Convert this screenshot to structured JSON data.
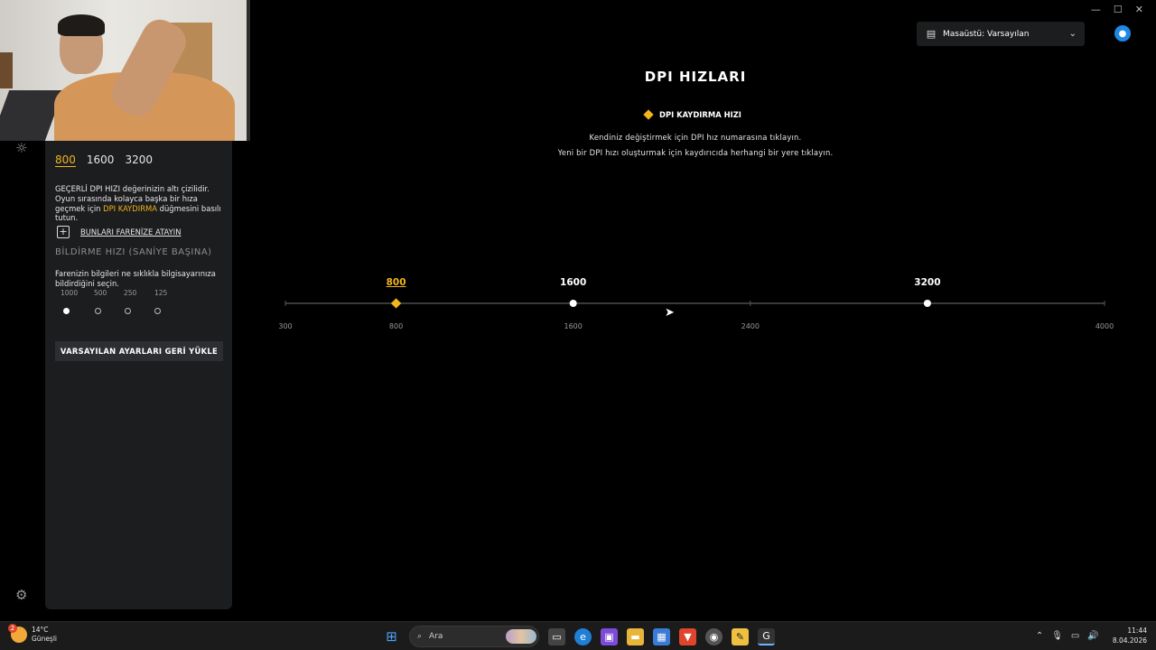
{
  "window_controls": {
    "minimize": "—",
    "maximize": "☐",
    "close": "✕"
  },
  "rail": {
    "light_icon": "light-icon",
    "settings_icon": "gear-icon"
  },
  "panel": {
    "dpi_values": [
      "800",
      "1600",
      "3200"
    ],
    "dpi_active_index": 0,
    "info_line1": "GEÇERLİ DPI HIZI değerinizin altı çizilidir.",
    "info_line2": "Oyun sırasında kolayca başka bir hıza",
    "info_line3_prefix": "geçmek için ",
    "info_line3_highlight": "DPI KAYDIRMA",
    "info_line3_suffix": " düğmesini basılı",
    "info_line4": "tutun.",
    "assign_label": "BUNLARI FARENİZE ATAYIN",
    "report_rate_title": "BİLDİRME HIZI (SANİYE BAŞINA)",
    "report_rate_desc1": "Farenizin bilgileri ne sıklıkla bilgisayarınıza",
    "report_rate_desc2": "bildirdiğini seçin.",
    "report_rates": [
      "1000",
      "500",
      "250",
      "125"
    ],
    "report_rate_selected": "1000",
    "reset_button": "VARSAYILAN AYARLARI GERİ YÜKLE"
  },
  "profile": {
    "label": "Masaüstü: Varsayılan",
    "icon": "desktop-icon"
  },
  "main": {
    "title": "DPI HIZLARI",
    "legend_label": "DPI KAYDIRMA HIZI",
    "hint1": "Kendiniz değiştirmek için DPI hız numarasına tıklayın.",
    "hint2": "Yeni bir DPI hızı oluşturmak için kaydırıcıda herhangi bir yere tıklayın."
  },
  "slider": {
    "min": 300,
    "max": 4000,
    "ticks": [
      300,
      800,
      1600,
      2400,
      4000
    ],
    "stages": [
      {
        "value": 800,
        "label": "800",
        "shift": true
      },
      {
        "value": 1600,
        "label": "1600",
        "shift": false
      },
      {
        "value": 3200,
        "label": "3200",
        "shift": false
      }
    ],
    "accent_color": "#f2b51c"
  },
  "taskbar": {
    "weather_temp": "14°C",
    "weather_desc": "Güneşli",
    "weather_badge": "2",
    "search_placeholder": "Ara",
    "clock_time": "11:44",
    "clock_date": "8.04.2026"
  }
}
